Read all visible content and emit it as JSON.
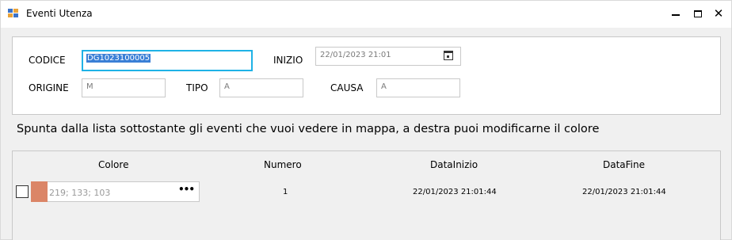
{
  "window": {
    "title": "Eventi Utenza"
  },
  "form": {
    "codice_label": "CODICE",
    "codice_value": "DG1023100005",
    "inizio_label": "INIZIO",
    "inizio_value": "22/01/2023 21:01",
    "origine_label": "ORIGINE",
    "origine_value": "M",
    "tipo_label": "TIPO",
    "tipo_value": "A",
    "causa_label": "CAUSA",
    "causa_value": "A"
  },
  "instruction": "Spunta dalla lista sottostante gli eventi che vuoi vedere in mappa, a destra puoi modificarne il colore",
  "grid": {
    "columns": [
      "Colore",
      "Numero",
      "DataInizio",
      "DataFine"
    ],
    "rows": [
      {
        "checked": false,
        "color": "#db8567",
        "color_text": "219; 133; 103",
        "numero": "1",
        "data_inizio": "22/01/2023 21:01:44",
        "data_fine": "22/01/2023 21:01:44"
      }
    ]
  },
  "icons": {
    "app": "app-icon",
    "calendar": "calendar-icon",
    "ellipsis": "ellipsis-icon"
  }
}
